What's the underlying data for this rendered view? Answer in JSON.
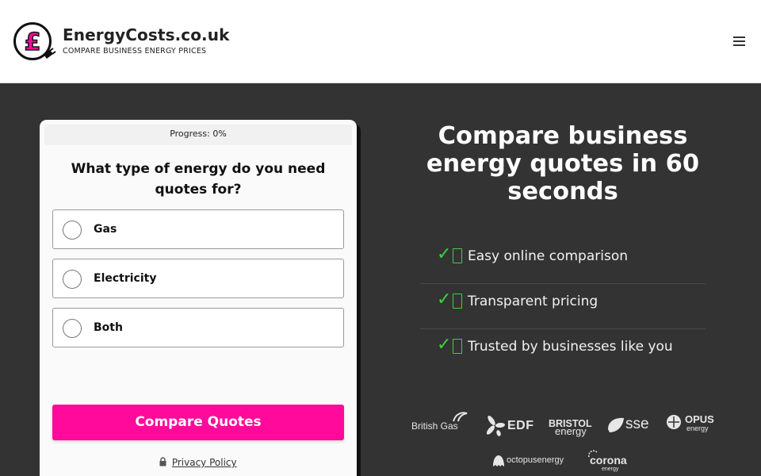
{
  "header": {
    "brand_name": "EnergyCosts.co.uk",
    "brand_tagline": "COMPARE BUSINESS ENERGY PRICES",
    "logo_symbol": "£",
    "logo_color": "#ff0a9b",
    "menu_icon": "hamburger-icon"
  },
  "form": {
    "progress_text": "Progress: 0%",
    "progress_value": 0,
    "question": "What type of energy do you need quotes for?",
    "options": [
      {
        "label": "Gas"
      },
      {
        "label": "Electricity"
      },
      {
        "label": "Both"
      }
    ],
    "submit_label": "Compare Quotes",
    "submit_color": "#ff0a9b",
    "privacy_label": "Privacy Policy",
    "privacy_icon": "lock-icon"
  },
  "hero": {
    "title": "Compare business energy quotes in 60 seconds",
    "features": [
      {
        "text": "Easy online comparison",
        "icon": "check-icon"
      },
      {
        "text": "Transparent pricing",
        "icon": "check-icon"
      },
      {
        "text": "Trusted by businesses like you",
        "icon": "check-icon"
      }
    ],
    "accent_color": "#3dd13d"
  },
  "suppliers": {
    "british_gas": "British Gas",
    "edf": "EDF",
    "bristol_main": "BRISTOL",
    "bristol_sub": "energy",
    "sse": "sse",
    "opus_main": "OPUS",
    "opus_sub": "energy",
    "octopus": "octopusenergy",
    "corona_main": "corona",
    "corona_sub": "energy"
  }
}
